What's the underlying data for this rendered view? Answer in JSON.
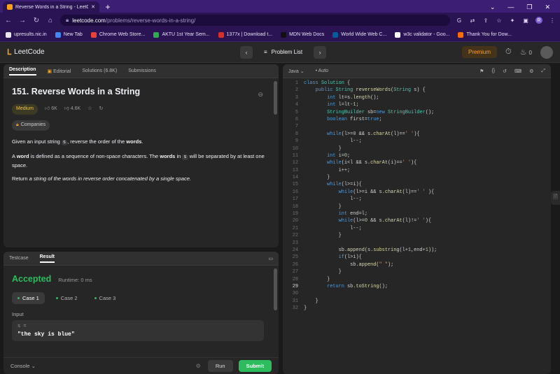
{
  "browser": {
    "tab_title": "Reverse Words in a String - LeetC",
    "url_host": "leetcode.com",
    "url_path": "/problems/reverse-words-in-a-string/",
    "bookmarks": [
      {
        "label": "upresults.nic.in",
        "color": "#e8e8e8"
      },
      {
        "label": "New Tab",
        "color": "#4285f4"
      },
      {
        "label": "Chrome Web Store...",
        "color": "#ea4335"
      },
      {
        "label": "AKTU 1st Year Sem...",
        "color": "#34a853"
      },
      {
        "label": "1377x | Download t...",
        "color": "#d93025"
      },
      {
        "label": "MDN Web Docs",
        "color": "#111111"
      },
      {
        "label": "World Wide Web C...",
        "color": "#005a9c"
      },
      {
        "label": "w3c validator - Goo...",
        "color": "#ffffff"
      },
      {
        "label": "Thank You for Dow...",
        "color": "#ff6d00"
      }
    ],
    "profile_initial": "R"
  },
  "header": {
    "logo_text": "LeetCode",
    "problem_list": "Problem List",
    "premium": "Premium",
    "streak": "0"
  },
  "description": {
    "tabs": [
      "Description",
      "Editorial",
      "Solutions (6.8K)",
      "Submissions"
    ],
    "title": "151. Reverse Words in a String",
    "difficulty": "Medium",
    "likes": "6K",
    "dislikes": "4.6K",
    "companies": "Companies",
    "p1_a": "Given an input string ",
    "p1_code": "s",
    "p1_b": ", reverse the order of the ",
    "p1_bold": "words",
    "p1_c": ".",
    "p2_a": "A ",
    "p2_bold1": "word",
    "p2_b": " is defined as a sequence of non-space characters. The ",
    "p2_bold2": "words",
    "p2_c": " in ",
    "p2_code": "s",
    "p2_d": " will be separated by at least one space.",
    "p3_a": "Return ",
    "p3_italic": "a string of the words in reverse order concatenated by a single space."
  },
  "result_panel": {
    "tabs": [
      "Testcase",
      "Result"
    ],
    "status": "Accepted",
    "runtime": "Runtime: 0 ms",
    "cases": [
      "Case 1",
      "Case 2",
      "Case 3"
    ],
    "input_label": "Input",
    "var_label": "s =",
    "input_value": "\"the sky is blue\"",
    "console": "Console",
    "run": "Run",
    "submit": "Submit"
  },
  "editor": {
    "language": "Java",
    "mode": "Auto",
    "current_line": 29,
    "lines": [
      "class Solution {",
      "    public String reverseWords(String s) {",
      "        int lt=s.length();",
      "        int l=lt-1;",
      "        StringBuilder sb=new StringBuilder();",
      "        boolean first=true;",
      "",
      "        while(l>=0 && s.charAt(l)==' '){",
      "                l--;",
      "            }",
      "        int i=0;",
      "        while(i<l && s.charAt(i)==' '){",
      "            i++;",
      "        }",
      "        while(l>=i){",
      "            while(l>=i && s.charAt(l)==' ' ){",
      "                l--;",
      "            }",
      "            int end=l;",
      "            while(l>=0 && s.charAt(l)!=' '){",
      "                l--;",
      "            }",
      "",
      "            sb.append(s.substring(l+1,end+1));",
      "            if(l>i){",
      "                sb.append(\" \");",
      "            }",
      "        }",
      "        return sb.toString();",
      "",
      "    }",
      "}"
    ]
  }
}
